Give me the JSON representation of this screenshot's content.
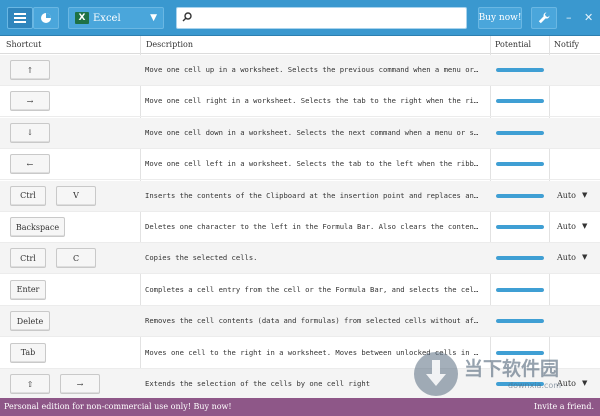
{
  "toolbar": {
    "app_name": "Excel",
    "search_value": "",
    "buy_label": "Buy now!"
  },
  "columns": {
    "shortcut": "Shortcut",
    "description": "Description",
    "potential": "Potential",
    "notify": "Notify"
  },
  "rows": [
    {
      "keys": [
        "↑"
      ],
      "description": "Move one cell up in a worksheet. Selects the previous command when a menu or submenu is open.",
      "potential": 1.0,
      "notify": ""
    },
    {
      "keys": [
        "→"
      ],
      "description": "Move one cell right in a worksheet. Selects the tab to the right when the ribbon is selected.",
      "potential": 1.0,
      "notify": ""
    },
    {
      "keys": [
        "↓"
      ],
      "description": "Move one cell down in a worksheet. Selects the next command when a menu or submenu is open.",
      "potential": 1.0,
      "notify": ""
    },
    {
      "keys": [
        "←"
      ],
      "description": "Move one cell left in a worksheet. Selects the tab to the left when the ribbon is selected.",
      "potential": 1.0,
      "notify": ""
    },
    {
      "keys": [
        "Ctrl",
        "V"
      ],
      "description": "Inserts the contents of the Clipboard at the insertion point and replaces any selection.",
      "potential": 1.0,
      "notify": "Auto"
    },
    {
      "keys": [
        "Backspace"
      ],
      "description": "Deletes one character to the left in the Formula Bar. Also clears the content of the active cell.",
      "potential": 1.0,
      "notify": "Auto"
    },
    {
      "keys": [
        "Ctrl",
        "C"
      ],
      "description": "Copies the selected cells.",
      "potential": 1.0,
      "notify": "Auto"
    },
    {
      "keys": [
        "Enter"
      ],
      "description": "Completes a cell entry from the cell or the Formula Bar, and selects the cell below.",
      "potential": 1.0,
      "notify": ""
    },
    {
      "keys": [
        "Delete"
      ],
      "description": "Removes the cell contents (data and formulas) from selected cells without affecting cell formats.",
      "potential": 1.0,
      "notify": ""
    },
    {
      "keys": [
        "Tab"
      ],
      "description": "Moves one cell to the right in a worksheet. Moves between unlocked cells in a protected worksheet.",
      "potential": 1.0,
      "notify": ""
    },
    {
      "keys": [
        "⇧",
        "→"
      ],
      "description": "Extends the selection of the cells by one cell right",
      "potential": 1.0,
      "notify": "Auto"
    }
  ],
  "footer": {
    "left": "Personal edition for non-commercial use only!  Buy now!",
    "right": "Invite a friend."
  },
  "watermark": {
    "title": "当下软件园",
    "sub": "downxia.com"
  },
  "colors": {
    "toolbar": "#3a98cf",
    "potential_fill": "#3f9fd4",
    "footer": "#8e5788"
  }
}
